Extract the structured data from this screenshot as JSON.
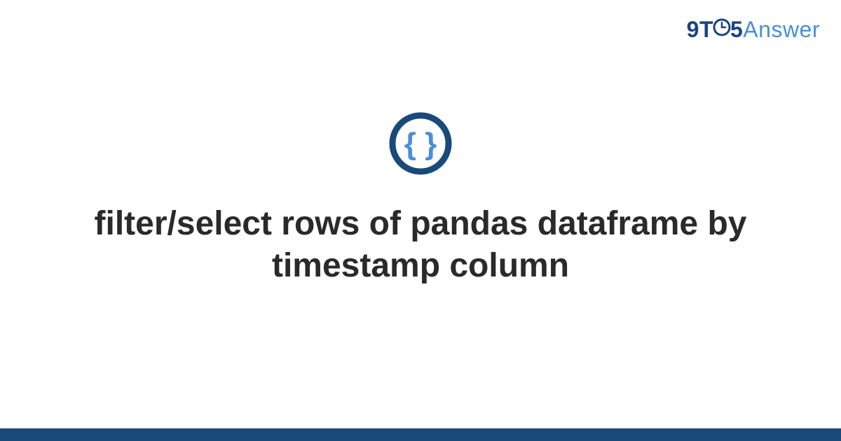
{
  "brand": {
    "part1": "9T",
    "part2": "5",
    "part3": "Answer"
  },
  "icon": {
    "name": "code-braces",
    "stroke_color": "#1a4a7a",
    "inner_color": "#4a8fd6"
  },
  "title": "filter/select rows of pandas dataframe by timestamp column",
  "colors": {
    "brand_dark": "#1a4480",
    "brand_light": "#4a8fd6",
    "bottom_bar": "#1a4a7a",
    "title_color": "#2a2a2a"
  }
}
